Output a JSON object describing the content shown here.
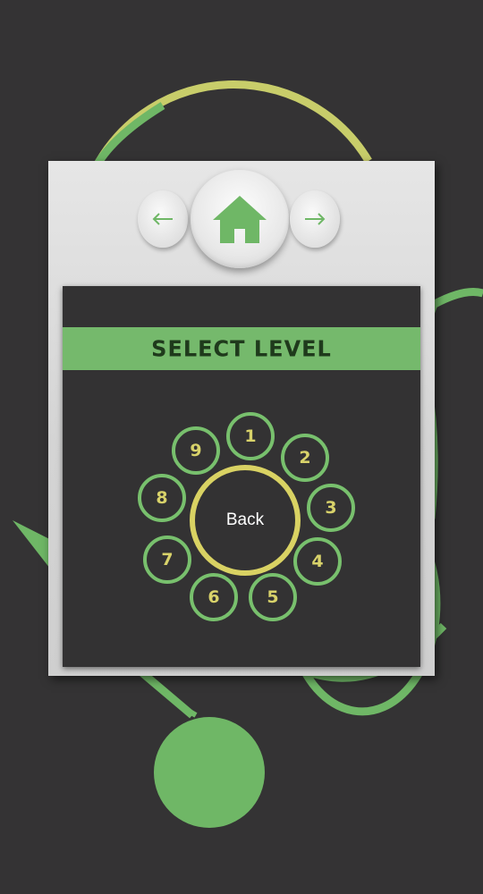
{
  "header": {
    "prev_icon": "arrow-left-icon",
    "home_icon": "home-icon",
    "next_icon": "arrow-right-icon"
  },
  "title": "Select Level",
  "levels": [
    "1",
    "2",
    "3",
    "4",
    "5",
    "6",
    "7",
    "8",
    "9"
  ],
  "back_label": "Back",
  "colors": {
    "background": "#343334",
    "accent_green": "#75b96c",
    "accent_yellow": "#d9d263",
    "panel": "#dcdcdc",
    "inner_panel": "#333233"
  }
}
